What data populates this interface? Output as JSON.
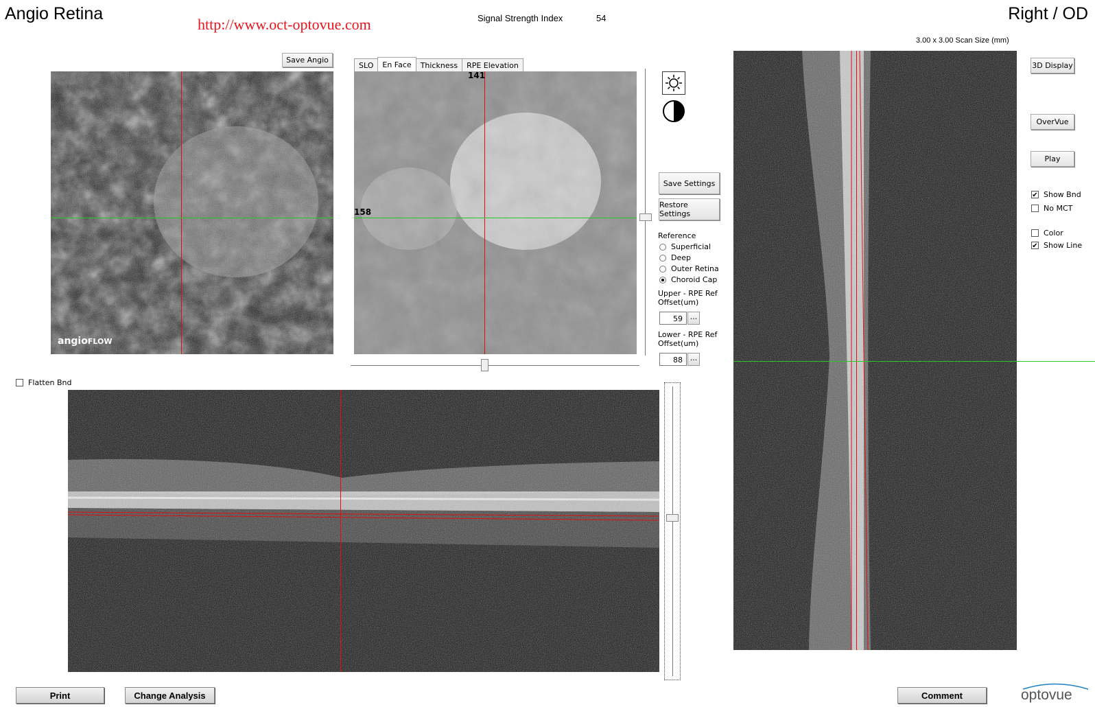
{
  "header": {
    "app_title": "Angio Retina",
    "url_watermark": "http://www.oct-optovue.com",
    "signal_strength_label": "Signal Strength Index",
    "signal_strength_value": "54",
    "eye": "Right / OD",
    "scan_size": "3.00 x 3.00 Scan Size (mm)"
  },
  "angio_panel": {
    "save_button": "Save Angio",
    "logo_main": "angio",
    "logo_suffix": "FLOW"
  },
  "enface_panel": {
    "tabs": [
      "SLO",
      "En Face",
      "Thickness",
      "RPE Elevation"
    ],
    "active_tab": "En Face",
    "x_marker": "141",
    "y_marker": "158"
  },
  "settings": {
    "save_settings": "Save Settings",
    "restore_settings": "Restore Settings",
    "reference_label": "Reference",
    "reference_options": [
      "Superficial",
      "Deep",
      "Outer Retina",
      "Choroid Cap"
    ],
    "reference_selected": "Choroid Cap",
    "upper_label_1": "Upper - RPE Ref",
    "upper_label_2": "Offset(um)",
    "upper_value": "59",
    "lower_label_1": "Lower - RPE Ref",
    "lower_label_2": "Offset(um)",
    "lower_value": "88",
    "ellipsis": "..."
  },
  "bscan": {
    "flatten_label": "Flatten Bnd",
    "flatten_checked": false
  },
  "right_controls": {
    "display_3d": "3D Display",
    "overvue": "OverVue",
    "play": "Play",
    "checkboxes": [
      {
        "label": "Show Bnd",
        "checked": true
      },
      {
        "label": "No MCT",
        "checked": false
      },
      {
        "label": "Color",
        "checked": false
      },
      {
        "label": "Show Line",
        "checked": true
      }
    ]
  },
  "footer": {
    "print": "Print",
    "change_analysis": "Change Analysis",
    "comment": "Comment",
    "brand": "optovue"
  },
  "colors": {
    "crosshair_red": "#e01010",
    "crosshair_green": "#22cc22",
    "url_red": "#e8141a",
    "brand_blue": "#1b7fc4"
  },
  "icons": {
    "brightness": "brightness-icon",
    "contrast": "contrast-icon"
  }
}
